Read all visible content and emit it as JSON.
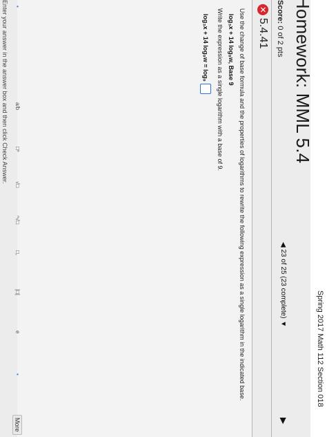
{
  "course": "Spring 2017 Math 112 Section 018",
  "homework_title": "Homework: MML 5.4",
  "score": {
    "label": "Score:",
    "value": "0 of 2 pts"
  },
  "progress": {
    "text": "23 of 25 (23 complete)"
  },
  "question_id": "5.4.41",
  "instruction": "Use the change of base formula and the properties of logarithms to rewrite the following expression as a single logarithm in the indicated base.",
  "expression": "log₃x + 14 log₉w, Base 9",
  "prompt": "Write the expression as a single logarithm with a base of 9.",
  "answer_line": "log₃x + 14 log₉w = log₉",
  "tools": [
    "▪",
    "a/b",
    "□ⁿ",
    "√□",
    "ⁿ√□",
    "□,",
    "|□|",
    "e",
    "▪",
    "More"
  ],
  "bottom_hint": "Enter your answer in the answer box and then click Check Answer.",
  "colors": {
    "accent": "#2f6fdb",
    "wrong": "#d8262c"
  }
}
